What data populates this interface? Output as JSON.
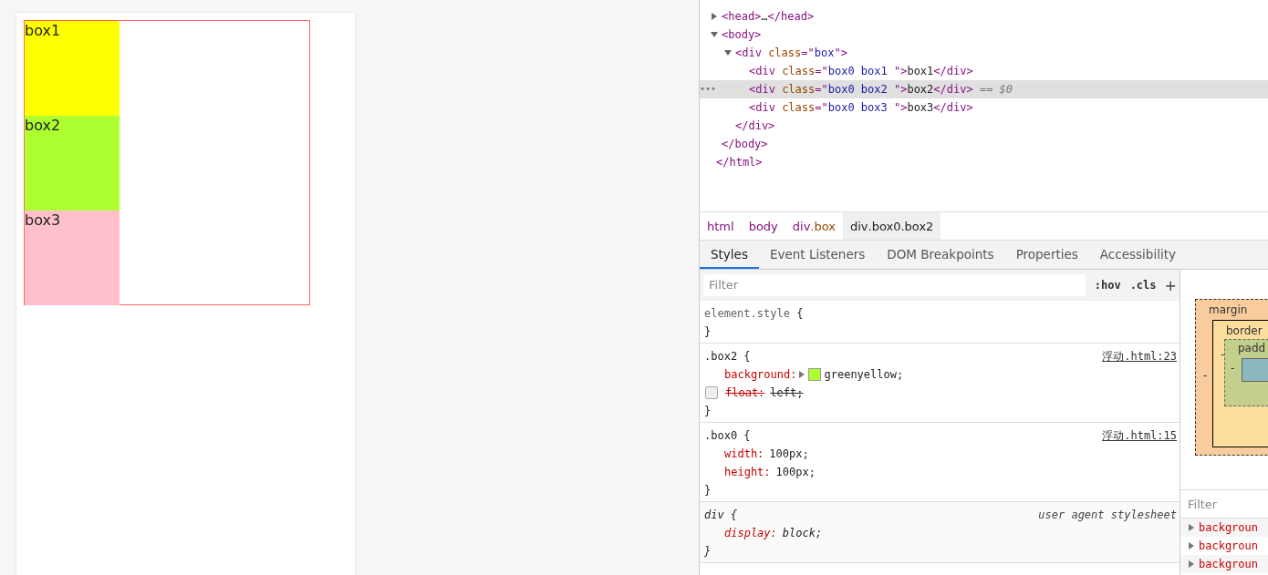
{
  "preview": {
    "boxes": [
      {
        "label": "box1",
        "color": "#ffff00"
      },
      {
        "label": "box2",
        "color": "#adff2f"
      },
      {
        "label": "box3",
        "color": "#ffc0cb"
      }
    ]
  },
  "dom_tree": {
    "closing": [
      {
        "text": "</html>",
        "kind": "tag"
      }
    ],
    "children": [
      {
        "expanded": false,
        "selected": false,
        "tokens": [
          {
            "text": "<head>",
            "kind": "tag"
          },
          {
            "text": "…",
            "kind": "text"
          },
          {
            "text": "</head>",
            "kind": "tag"
          }
        ]
      },
      {
        "expanded": true,
        "selected": false,
        "tokens": [
          {
            "text": "<body>",
            "kind": "tag"
          }
        ],
        "closing": [
          {
            "text": "</body>",
            "kind": "tag"
          }
        ],
        "children": [
          {
            "expanded": true,
            "selected": false,
            "tokens": [
              {
                "text": "<div",
                "kind": "tag"
              },
              {
                "text": " class",
                "kind": "attr"
              },
              {
                "text": "=\"",
                "kind": "tag"
              },
              {
                "text": "box",
                "kind": "value"
              },
              {
                "text": "\">",
                "kind": "tag"
              }
            ],
            "closing": [
              {
                "text": "</div>",
                "kind": "tag"
              }
            ],
            "children": [
              {
                "selected": false,
                "tokens": [
                  {
                    "text": "<div",
                    "kind": "tag"
                  },
                  {
                    "text": " class",
                    "kind": "attr"
                  },
                  {
                    "text": "=\"",
                    "kind": "tag"
                  },
                  {
                    "text": "box0 box1 ",
                    "kind": "value"
                  },
                  {
                    "text": "\">",
                    "kind": "tag"
                  },
                  {
                    "text": "box1",
                    "kind": "text"
                  },
                  {
                    "text": "</div>",
                    "kind": "tag"
                  }
                ]
              },
              {
                "selected": true,
                "marker": "•••",
                "tokens": [
                  {
                    "text": "<div",
                    "kind": "tag"
                  },
                  {
                    "text": " class",
                    "kind": "attr"
                  },
                  {
                    "text": "=\"",
                    "kind": "tag"
                  },
                  {
                    "text": "box0 box2 ",
                    "kind": "value"
                  },
                  {
                    "text": "\">",
                    "kind": "tag"
                  },
                  {
                    "text": "box2",
                    "kind": "text"
                  },
                  {
                    "text": "</div>",
                    "kind": "tag"
                  },
                  {
                    "text": " == ",
                    "kind": "note"
                  },
                  {
                    "text": "$0",
                    "kind": "note-italic"
                  }
                ]
              },
              {
                "selected": false,
                "tokens": [
                  {
                    "text": "<div",
                    "kind": "tag"
                  },
                  {
                    "text": " class",
                    "kind": "attr"
                  },
                  {
                    "text": "=\"",
                    "kind": "tag"
                  },
                  {
                    "text": "box0 box3 ",
                    "kind": "value"
                  },
                  {
                    "text": "\">",
                    "kind": "tag"
                  },
                  {
                    "text": "box3",
                    "kind": "text"
                  },
                  {
                    "text": "</div>",
                    "kind": "tag"
                  }
                ]
              }
            ]
          }
        ]
      }
    ]
  },
  "breadcrumbs": [
    {
      "tag": "html",
      "selected": false
    },
    {
      "tag": "body",
      "selected": false
    },
    {
      "tag": "div",
      "cls": ".box",
      "selected": false
    },
    {
      "tag": "div",
      "cls": ".box0.box2",
      "selected": true
    }
  ],
  "tabs": [
    {
      "label": "Styles",
      "selected": true
    },
    {
      "label": "Event Listeners",
      "selected": false
    },
    {
      "label": "DOM Breakpoints",
      "selected": false
    },
    {
      "label": "Properties",
      "selected": false
    },
    {
      "label": "Accessibility",
      "selected": false
    }
  ],
  "styles": {
    "filter": {
      "placeholder": "Filter"
    },
    "hov": ":hov",
    "cls": ".cls",
    "add": "+",
    "rules": [
      {
        "selector": "element.style",
        "kind": "inline",
        "open": "{",
        "close": "}"
      },
      {
        "selector": ".box2",
        "kind": "author",
        "open": "{",
        "close": "}",
        "source": "浮动.html:23",
        "properties": [
          {
            "name": "background:",
            "value": "greenyellow;",
            "color": "#adff2f",
            "expandable": true,
            "struck": false
          },
          {
            "name": "float:",
            "value": "left;",
            "struck": true,
            "checkbox": {
              "checked": false
            }
          }
        ]
      },
      {
        "selector": ".box0",
        "kind": "author",
        "open": "{",
        "close": "}",
        "source": "浮动.html:15",
        "properties": [
          {
            "name": "width:",
            "value": "100px;",
            "struck": false
          },
          {
            "name": "height:",
            "value": "100px;",
            "struck": false
          }
        ]
      },
      {
        "selector": "div",
        "kind": "user-agent",
        "open": "{",
        "close": "}",
        "source": "user agent stylesheet",
        "properties": [
          {
            "name": "display:",
            "value": "block;",
            "struck": false
          }
        ]
      }
    ]
  },
  "box_model": {
    "margin": "margin",
    "border": "border",
    "padding": "padd",
    "margin_left": "-",
    "border_left": "-",
    "padding_left": "-"
  },
  "computed": {
    "filter": {
      "placeholder": "Filter"
    },
    "rows": [
      {
        "name": "backgroun"
      },
      {
        "name": "backgroun"
      },
      {
        "name": "backgroun"
      }
    ]
  }
}
